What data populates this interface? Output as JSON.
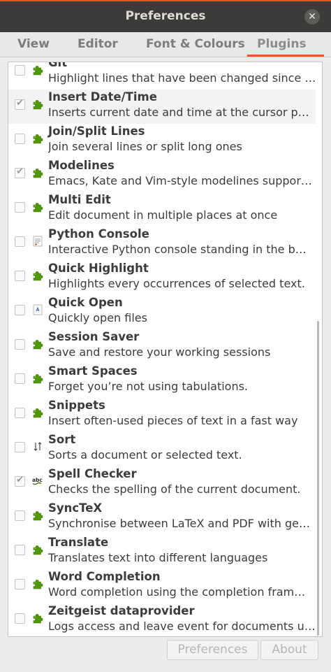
{
  "window": {
    "title": "Preferences",
    "close_glyph": "✕"
  },
  "tabs": [
    {
      "label": "View"
    },
    {
      "label": "Editor"
    },
    {
      "label": "Font & Colours"
    },
    {
      "label": "Plugins",
      "active": true
    }
  ],
  "accent_color": "#e95420",
  "plugins": [
    {
      "name": "Git",
      "description": "Highlight lines that have been changed since …",
      "checked": false,
      "icon": "puzzle-icon"
    },
    {
      "name": "Insert Date/Time",
      "description": "Inserts current date and time at the cursor p…",
      "checked": true,
      "icon": "puzzle-icon",
      "selected": true
    },
    {
      "name": "Join/Split Lines",
      "description": "Join several lines or split long ones",
      "checked": false,
      "icon": "puzzle-icon"
    },
    {
      "name": "Modelines",
      "description": "Emacs, Kate and Vim-style modelines suppor…",
      "checked": true,
      "icon": "puzzle-icon"
    },
    {
      "name": "Multi Edit",
      "description": "Edit document in multiple places at once",
      "checked": false,
      "icon": "puzzle-icon"
    },
    {
      "name": "Python Console",
      "description": "Interactive Python console standing in the b…",
      "checked": false,
      "icon": "console-icon"
    },
    {
      "name": "Quick Highlight",
      "description": "Highlights every occurrences of selected text.",
      "checked": false,
      "icon": "puzzle-icon"
    },
    {
      "name": "Quick Open",
      "description": "Quickly open files",
      "checked": false,
      "icon": "document-icon"
    },
    {
      "name": "Session Saver",
      "description": "Save and restore your working sessions",
      "checked": false,
      "icon": "puzzle-icon"
    },
    {
      "name": "Smart Spaces",
      "description": "Forget you’re not using tabulations.",
      "checked": false,
      "icon": "puzzle-icon"
    },
    {
      "name": "Snippets",
      "description": "Insert often-used pieces of text in a fast way",
      "checked": false,
      "icon": "puzzle-icon"
    },
    {
      "name": "Sort",
      "description": "Sorts a document or selected text.",
      "checked": false,
      "icon": "sort-icon"
    },
    {
      "name": "Spell Checker",
      "description": "Checks the spelling of the current document.",
      "checked": true,
      "icon": "spellcheck-icon"
    },
    {
      "name": "SyncTeX",
      "description": "Synchronise between LaTeX and PDF with ge…",
      "checked": false,
      "icon": "puzzle-icon"
    },
    {
      "name": "Translate",
      "description": "Translates text into different languages",
      "checked": false,
      "icon": "puzzle-icon"
    },
    {
      "name": "Word Completion",
      "description": "Word completion using the completion fram…",
      "checked": false,
      "icon": "puzzle-icon"
    },
    {
      "name": "Zeitgeist dataprovider",
      "description": "Logs access and leave event for documents u…",
      "checked": false,
      "icon": "puzzle-icon"
    }
  ],
  "buttons": {
    "preferences_label": "Preferences",
    "about_label": "About"
  }
}
